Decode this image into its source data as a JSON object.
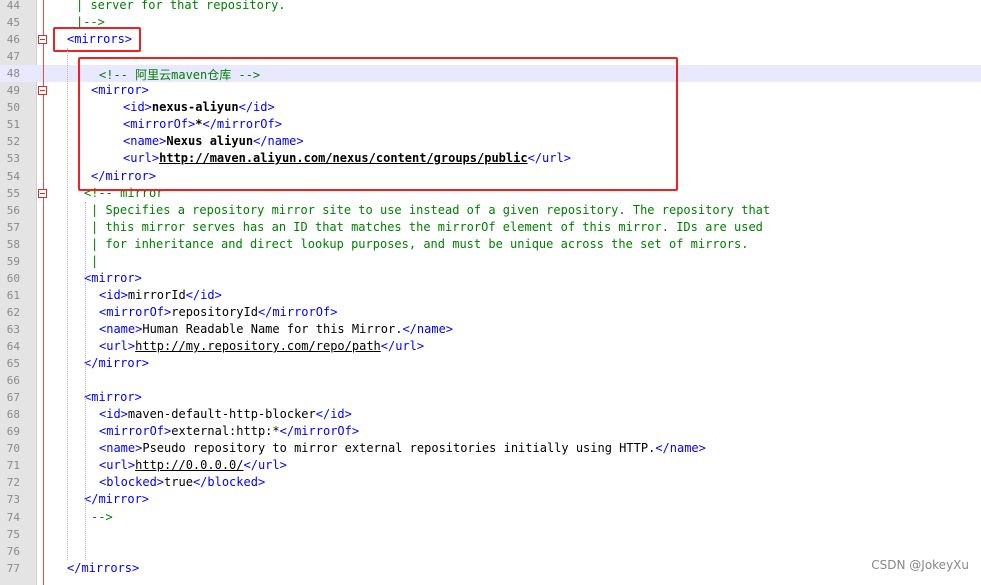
{
  "editor": {
    "lines": [
      {
        "no": "44",
        "code": "| server for that repository."
      },
      {
        "no": "45",
        "code": "|-->"
      },
      {
        "no": "46",
        "code": "<mirrors>"
      },
      {
        "no": "47",
        "code": ""
      },
      {
        "no": "48",
        "code": "<!-- 阿里云maven仓库 -->"
      },
      {
        "no": "49",
        "code": "<mirror>"
      },
      {
        "no": "50",
        "code": "<id>nexus-aliyun</id>"
      },
      {
        "no": "51",
        "code": "<mirrorOf>*</mirrorOf>"
      },
      {
        "no": "52",
        "code": "<name>Nexus aliyun</name>"
      },
      {
        "no": "53",
        "code": "<url>http://maven.aliyun.com/nexus/content/groups/public</url>"
      },
      {
        "no": "54",
        "code": "</mirror>"
      },
      {
        "no": "55",
        "code": "<!-- mirror"
      },
      {
        "no": "56",
        "code": "| Specifies a repository mirror site to use instead of a given repository. The repository that"
      },
      {
        "no": "57",
        "code": "| this mirror serves has an ID that matches the mirrorOf element of this mirror. IDs are used"
      },
      {
        "no": "58",
        "code": "| for inheritance and direct lookup purposes, and must be unique across the set of mirrors."
      },
      {
        "no": "59",
        "code": "|"
      },
      {
        "no": "60",
        "code": "<mirror>"
      },
      {
        "no": "61",
        "code": "<id>mirrorId</id>"
      },
      {
        "no": "62",
        "code": "<mirrorOf>repositoryId</mirrorOf>"
      },
      {
        "no": "63",
        "code": "<name>Human Readable Name for this Mirror.</name>"
      },
      {
        "no": "64",
        "code": "<url>http://my.repository.com/repo/path</url>"
      },
      {
        "no": "65",
        "code": "</mirror>"
      },
      {
        "no": "66",
        "code": ""
      },
      {
        "no": "67",
        "code": "<mirror>"
      },
      {
        "no": "68",
        "code": "<id>maven-default-http-blocker</id>"
      },
      {
        "no": "69",
        "code": "<mirrorOf>external:http:*</mirrorOf>"
      },
      {
        "no": "70",
        "code": "<name>Pseudo repository to mirror external repositories initially using HTTP.</name>"
      },
      {
        "no": "71",
        "code": "<url>http://0.0.0.0/</url>"
      },
      {
        "no": "72",
        "code": "<blocked>true</blocked>"
      },
      {
        "no": "73",
        "code": "</mirror>"
      },
      {
        "no": "74",
        "code": "-->"
      },
      {
        "no": "75",
        "code": ""
      },
      {
        "no": "76",
        "code": ""
      },
      {
        "no": "77",
        "code": "</mirrors>"
      }
    ],
    "highlighted_line": "48"
  },
  "watermark": "CSDN @JokeyXu",
  "colors": {
    "tag": "#0000ff",
    "comment": "#008000",
    "text": "#000000",
    "annotation_box": "#ee2222",
    "current_line": "#e8e8ff",
    "fold_marker": "#ff4444"
  },
  "icons": [
    "fold-collapse-icon"
  ]
}
